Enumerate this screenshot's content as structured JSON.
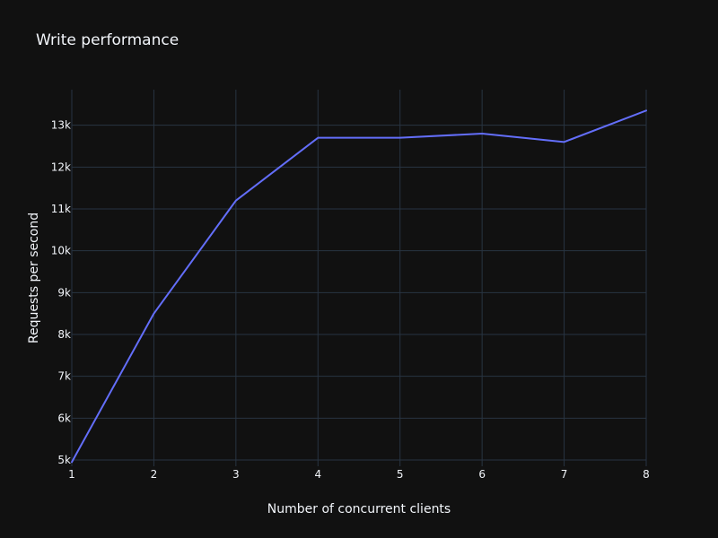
{
  "colors": {
    "background": "#111111",
    "grid": "#283442",
    "text": "#f2f5fa",
    "series": "#636efa"
  },
  "chart_data": {
    "type": "line",
    "title": "Write performance",
    "xlabel": "Number of concurrent clients",
    "ylabel": "Requests per second",
    "grid": true,
    "xlim": [
      1,
      8
    ],
    "ylim": [
      4850,
      13850
    ],
    "x_ticks": [
      1,
      2,
      3,
      4,
      5,
      6,
      7,
      8
    ],
    "x_tick_labels": [
      "1",
      "2",
      "3",
      "4",
      "5",
      "6",
      "7",
      "8"
    ],
    "y_ticks": [
      5000,
      6000,
      7000,
      8000,
      9000,
      10000,
      11000,
      12000,
      13000
    ],
    "y_tick_labels": [
      "5k",
      "6k",
      "7k",
      "8k",
      "9k",
      "10k",
      "11k",
      "12k",
      "13k"
    ],
    "series": [
      {
        "x": [
          1,
          2,
          3,
          4,
          5,
          6,
          7,
          8
        ],
        "values": [
          4950,
          8500,
          11200,
          12700,
          12700,
          12800,
          12600,
          13350
        ]
      }
    ]
  }
}
